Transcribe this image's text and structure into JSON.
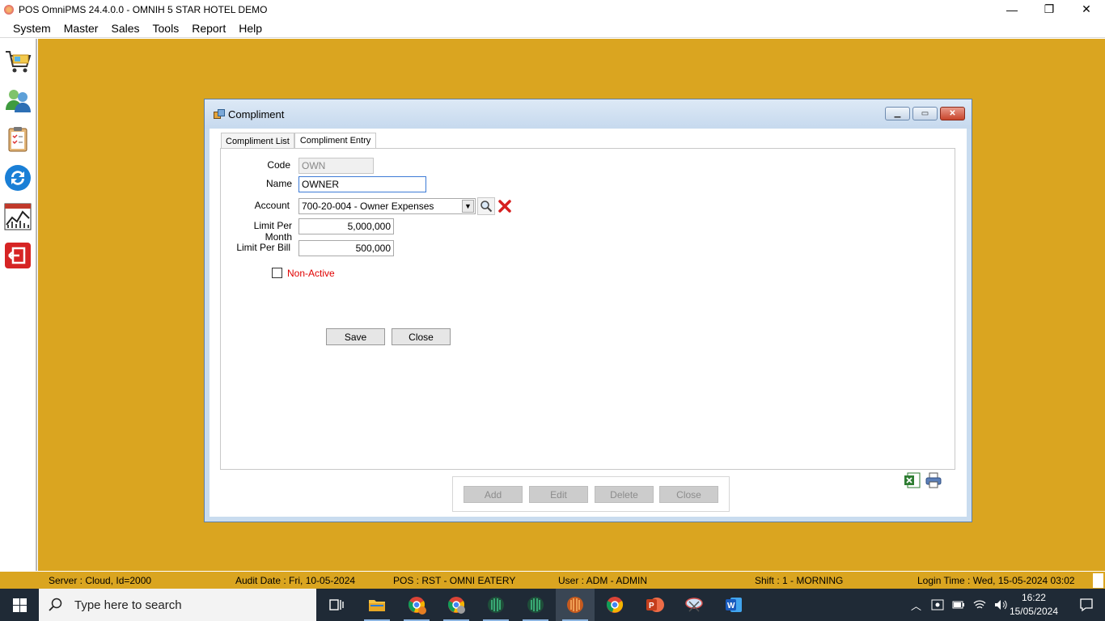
{
  "app": {
    "title": "POS OmniPMS 24.4.0.0 - OMNIH 5 STAR HOTEL DEMO",
    "window_controls": {
      "minimize": "—",
      "restore": "❐",
      "close": "✕"
    }
  },
  "menu": [
    "System",
    "Master",
    "Sales",
    "Tools",
    "Report",
    "Help"
  ],
  "left_toolbar": [
    "cart-icon",
    "users-icon",
    "clipboard-icon",
    "refresh-icon",
    "chart-icon",
    "exit-icon"
  ],
  "dialog": {
    "title": "Compliment",
    "tabs": [
      {
        "label": "Compliment List",
        "active": false
      },
      {
        "label": "Compliment Entry",
        "active": true
      }
    ],
    "form": {
      "code_label": "Code",
      "code_value": "OWN",
      "name_label": "Name",
      "name_value": "OWNER",
      "account_label": "Account",
      "account_value": "700-20-004 - Owner Expenses",
      "limit_month_label": "Limit Per Month",
      "limit_month_value": "5,000,000",
      "limit_bill_label": "Limit Per Bill",
      "limit_bill_value": "500,000",
      "nonactive_label": "Non-Active",
      "nonactive_checked": false
    },
    "actions": {
      "save": "Save",
      "close": "Close"
    },
    "bottom_buttons": {
      "add": "Add",
      "edit": "Edit",
      "delete": "Delete",
      "close": "Close"
    }
  },
  "status": {
    "server": "Server : Cloud, Id=2000",
    "audit_date": "Audit Date : Fri, 10-05-2024",
    "pos": "POS : RST - OMNI EATERY",
    "user": "User : ADM - ADMIN",
    "shift": "Shift : 1 - MORNING",
    "login_time": "Login Time : Wed, 15-05-2024 03:02"
  },
  "taskbar": {
    "search_placeholder": "Type here to search",
    "time": "16:22",
    "date": "15/05/2024"
  },
  "colors": {
    "mdi_background": "#daa520",
    "nonactive_text": "#e00000",
    "taskbar": "#1f2a36"
  }
}
